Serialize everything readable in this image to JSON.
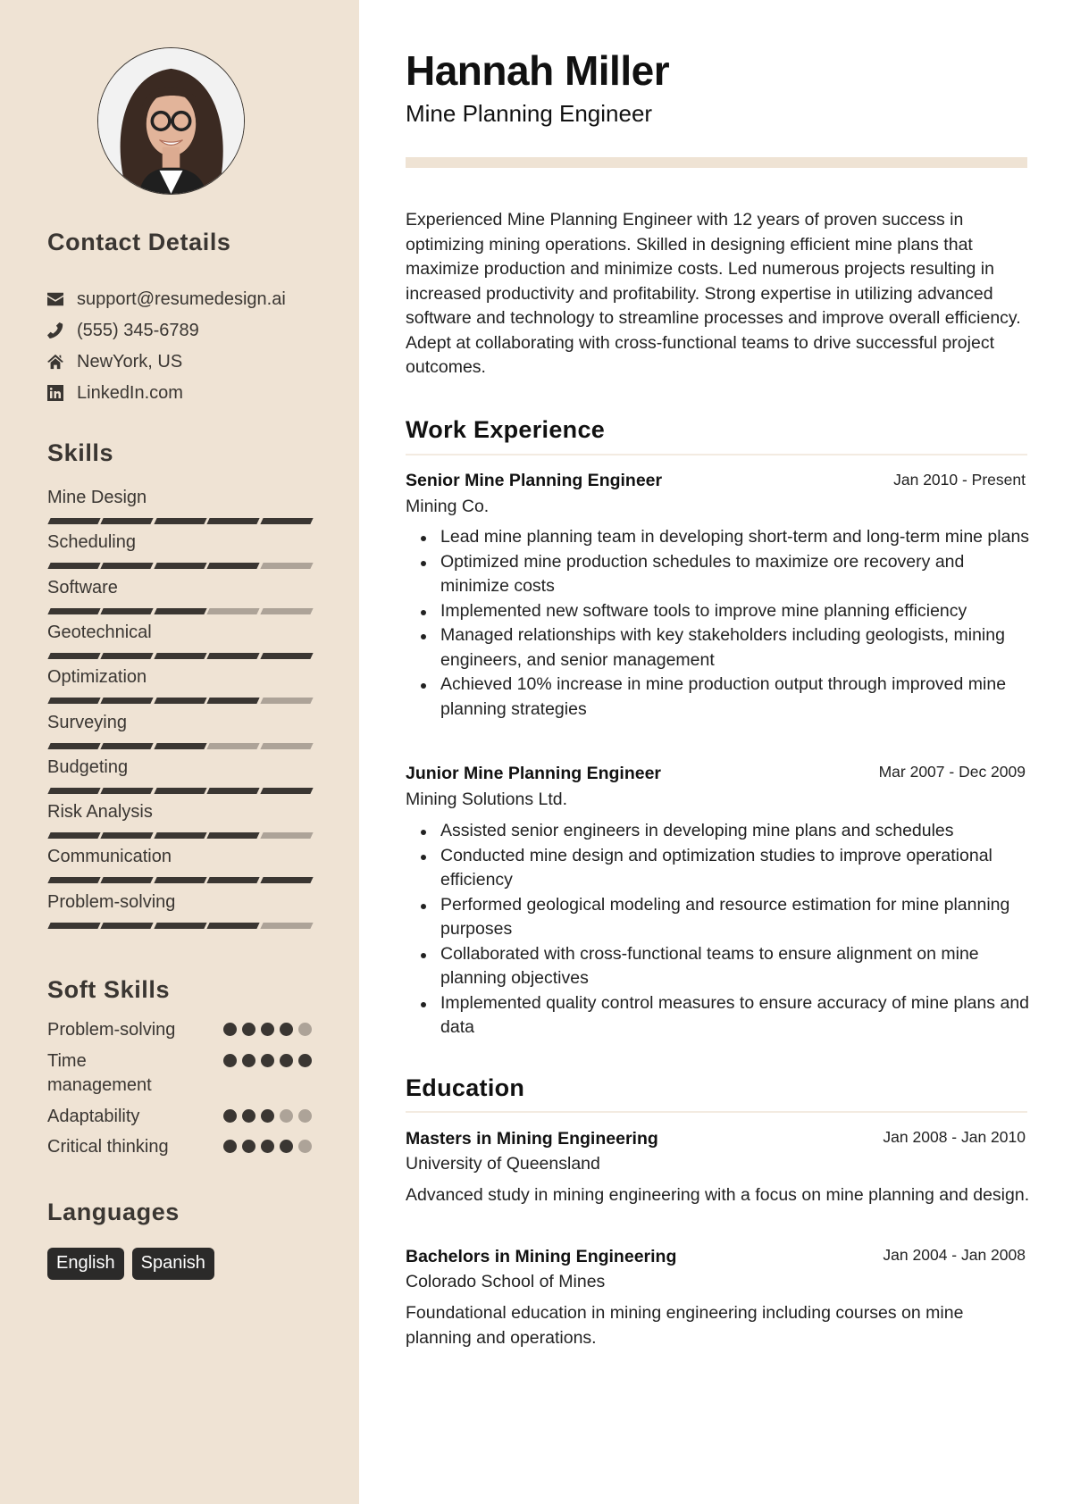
{
  "profile": {
    "name": "Hannah Miller",
    "title": "Mine Planning Engineer",
    "photo_alt": "Profile photo"
  },
  "colors": {
    "sidebar_bg": "#efe3d4",
    "accent_dark": "#3a3632",
    "accent_light": "#ada398",
    "tag_bg": "#2b2a29"
  },
  "contact": {
    "heading": "Contact Details",
    "items": [
      {
        "icon": "envelope-icon",
        "text": "support@resumedesign.ai"
      },
      {
        "icon": "phone-icon",
        "text": "(555) 345-6789"
      },
      {
        "icon": "home-icon",
        "text": "NewYork, US"
      },
      {
        "icon": "linkedin-icon",
        "text": "LinkedIn.com"
      }
    ]
  },
  "skills": {
    "heading": "Skills",
    "max": 5,
    "items": [
      {
        "label": "Mine Design",
        "level": 5
      },
      {
        "label": "Scheduling",
        "level": 4
      },
      {
        "label": "Software",
        "level": 3
      },
      {
        "label": "Geotechnical",
        "level": 5
      },
      {
        "label": "Optimization",
        "level": 4
      },
      {
        "label": "Surveying",
        "level": 3
      },
      {
        "label": "Budgeting",
        "level": 5
      },
      {
        "label": "Risk Analysis",
        "level": 4
      },
      {
        "label": "Communication",
        "level": 5
      },
      {
        "label": "Problem-solving",
        "level": 4
      }
    ]
  },
  "soft_skills": {
    "heading": "Soft Skills",
    "max": 5,
    "items": [
      {
        "label": "Problem-solving",
        "level": 4
      },
      {
        "label": "Time management",
        "level": 5
      },
      {
        "label": "Adaptability",
        "level": 3
      },
      {
        "label": "Critical thinking",
        "level": 4
      }
    ]
  },
  "languages": {
    "heading": "Languages",
    "items": [
      "English",
      "Spanish"
    ]
  },
  "summary": "Experienced Mine Planning Engineer with 12 years of proven success in optimizing mining operations. Skilled in designing efficient mine plans that maximize production and minimize costs. Led numerous projects resulting in increased productivity and profitability. Strong expertise in utilizing advanced software and technology to streamline processes and improve overall efficiency. Adept at collaborating with cross-functional teams to drive successful project outcomes.",
  "work": {
    "heading": "Work Experience",
    "jobs": [
      {
        "title": "Senior Mine Planning Engineer",
        "date": "Jan 2010 - Present",
        "company": "Mining Co.",
        "bullets": [
          "Lead mine planning team in developing short-term and long-term mine plans",
          "Optimized mine production schedules to maximize ore recovery and minimize costs",
          "Implemented new software tools to improve mine planning efficiency",
          "Managed relationships with key stakeholders including geologists, mining engineers, and senior management",
          "Achieved 10% increase in mine production output through improved mine planning strategies"
        ]
      },
      {
        "title": "Junior Mine Planning Engineer",
        "date": "Mar 2007 - Dec 2009",
        "company": "Mining Solutions Ltd.",
        "bullets": [
          "Assisted senior engineers in developing mine plans and schedules",
          "Conducted mine design and optimization studies to improve operational efficiency",
          "Performed geological modeling and resource estimation for mine planning purposes",
          "Collaborated with cross-functional teams to ensure alignment on mine planning objectives",
          "Implemented quality control measures to ensure accuracy of mine plans and data"
        ]
      }
    ]
  },
  "education": {
    "heading": "Education",
    "items": [
      {
        "degree": "Masters in Mining Engineering",
        "date": "Jan 2008 - Jan 2010",
        "school": "University of Queensland",
        "description": "Advanced study in mining engineering with a focus on mine planning and design."
      },
      {
        "degree": "Bachelors in Mining Engineering",
        "date": "Jan 2004 - Jan 2008",
        "school": "Colorado School of Mines",
        "description": "Foundational education in mining engineering including courses on mine planning and operations."
      }
    ]
  }
}
